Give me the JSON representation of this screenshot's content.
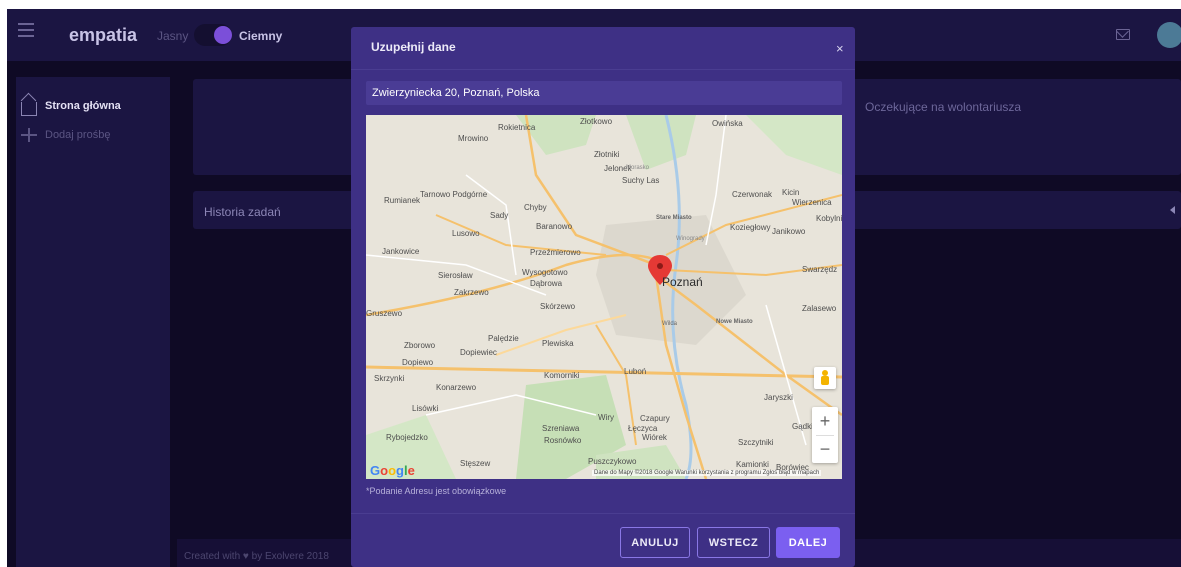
{
  "app": {
    "brand": "empatia",
    "theme_light": "Jasny",
    "theme_dark": "Ciemny",
    "theme_selected": "Ciemny"
  },
  "sidebar": {
    "items": [
      {
        "label": "Strona główna",
        "icon": "home-icon"
      },
      {
        "label": "Dodaj prośbę",
        "icon": "plus-icon"
      }
    ]
  },
  "main": {
    "pending_label": "Oczekujące na wolontariusza",
    "history_label": "Historia zadań"
  },
  "footer": {
    "text": "Created with ♥ by Exolvere 2018"
  },
  "modal": {
    "title": "Uzupełnij dane",
    "close_symbol": "×",
    "address_value": "Zwierzyniecka 20, Poznań, Polska",
    "map": {
      "selected_city": "Poznań",
      "labels": [
        "Złotkowo",
        "Owińska",
        "Rokietnica",
        "Mrowino",
        "Złotniki",
        "Jelonek",
        "Suchy Las",
        "Tarnowo Podgórne",
        "Rumianek",
        "Chyby",
        "Sady",
        "Baranowo",
        "Lusowo",
        "Czerwonak",
        "Kicin",
        "Wierzenica",
        "Koziegłowy",
        "Janikowo",
        "Kobylnica",
        "Przeźmierowo",
        "Jankowice",
        "Wysogotowo",
        "Dąbrowa",
        "Sierosław",
        "Zakrzewo",
        "Skórzewo",
        "Swarzędz",
        "Zalasewo",
        "Palędzie",
        "Plewiska",
        "Zborowo",
        "Dopiewiec",
        "Dopiewo",
        "Komorniki",
        "Luboń",
        "Skrzynki",
        "Konarzewo",
        "Jaryszki",
        "Lisówki",
        "Szreniawa",
        "Wiry",
        "Czapury",
        "Łęczyca",
        "Gądki",
        "Rybojedzko",
        "Rosnówko",
        "Wiórek",
        "Szczytniki",
        "Stęszew",
        "Puszczykowo",
        "Kamionki",
        "Borówiec",
        "Stare Miasto",
        "Winogrady",
        "Nowe Miasto",
        "Wilda",
        "Morasko",
        "Gruszewo"
      ],
      "google_logo": "Google",
      "attribution": "Dane do Mapy ©2018 Google   Warunki korzystania z programu   Zgłoś błąd w mapach"
    },
    "required_note": "*Podanie Adresu jest obowiązkowe",
    "buttons": {
      "cancel": "ANULUJ",
      "back": "WSTECZ",
      "next": "DALEJ"
    }
  },
  "colors": {
    "background": "#0f0a25",
    "panel": "#1b1542",
    "modal": "#3e3085",
    "accent": "#7b5ff0",
    "map_marker": "#e53935"
  }
}
